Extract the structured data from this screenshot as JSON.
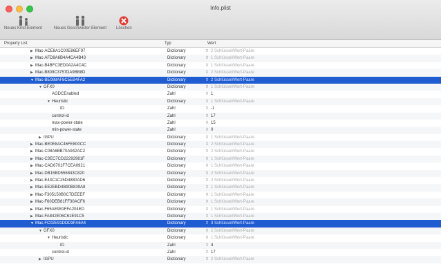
{
  "window": {
    "title": "Info.plist"
  },
  "toolbar": {
    "add_child": "Neues Kind-Element",
    "add_sibling": "Neues Geschwister-Element",
    "delete": "Löschen"
  },
  "columns": {
    "key": "Property List",
    "type": "Typ",
    "value": "Wert"
  },
  "rows": [
    {
      "key": "Mac-ACE8A1C00E86EF97",
      "type": "Dictionary",
      "value": "2 Schlüssel/Wert-Paare",
      "indent": 3,
      "disclosure": "closed",
      "selected": false
    },
    {
      "key": "Mac-AFD8A6B4A4CA4B43",
      "type": "Dictionary",
      "value": "1 Schlüssel/Wert-Paare",
      "indent": 3,
      "disclosure": "closed",
      "selected": false
    },
    {
      "key": "Mac-B4BFC3ED0A2A4C4C",
      "type": "Dictionary",
      "value": "1 Schlüssel/Wert-Paare",
      "indent": 3,
      "disclosure": "closed",
      "selected": false
    },
    {
      "key": "Mac-B809C3757DA9BB8D",
      "type": "Dictionary",
      "value": "2 Schlüssel/Wert-Paare",
      "indent": 3,
      "disclosure": "closed",
      "selected": false
    },
    {
      "key": "Mac-BE088AF8C5EB4FA2",
      "type": "Dictionary",
      "value": "2 Schlüssel/Wert-Paare",
      "indent": 3,
      "disclosure": "open",
      "selected": true
    },
    {
      "key": "GFX0",
      "type": "Dictionary",
      "value": "1 Schlüssel/Wert-Paare",
      "indent": 4,
      "disclosure": "open",
      "selected": false
    },
    {
      "key": "AGDCEnabled",
      "type": "Zahl",
      "value": "1",
      "indent": 5,
      "disclosure": "none",
      "selected": false
    },
    {
      "key": "Heuristic",
      "type": "Dictionary",
      "value": "1 Schlüssel/Wert-Paare",
      "indent": 5,
      "disclosure": "open",
      "selected": false
    },
    {
      "key": "ID",
      "type": "Zahl",
      "value": "-1",
      "indent": 6,
      "disclosure": "none",
      "selected": false
    },
    {
      "key": "control-id",
      "type": "Zahl",
      "value": "17",
      "indent": 5,
      "disclosure": "none",
      "selected": false
    },
    {
      "key": "max-power-state",
      "type": "Zahl",
      "value": "15",
      "indent": 5,
      "disclosure": "none",
      "selected": false
    },
    {
      "key": "min-power-state",
      "type": "Zahl",
      "value": "0",
      "indent": 5,
      "disclosure": "none",
      "selected": false
    },
    {
      "key": "IGPU",
      "type": "Dictionary",
      "value": "1 Schlüssel/Wert-Paare",
      "indent": 4,
      "disclosure": "closed",
      "selected": false
    },
    {
      "key": "Mac-BE0E8AC46FE800CC",
      "type": "Dictionary",
      "value": "2 Schlüssel/Wert-Paare",
      "indent": 3,
      "disclosure": "closed",
      "selected": false
    },
    {
      "key": "Mac-C08A6BB70A942AC2",
      "type": "Dictionary",
      "value": "2 Schlüssel/Wert-Paare",
      "indent": 3,
      "disclosure": "closed",
      "selected": false
    },
    {
      "key": "Mac-C3EC7CD22292981F",
      "type": "Dictionary",
      "value": "1 Schlüssel/Wert-Paare",
      "indent": 3,
      "disclosure": "closed",
      "selected": false
    },
    {
      "key": "Mac-CAD6701F7CEA0921",
      "type": "Dictionary",
      "value": "1 Schlüssel/Wert-Paare",
      "indent": 3,
      "disclosure": "closed",
      "selected": false
    },
    {
      "key": "Mac-DB15BD556843C820",
      "type": "Dictionary",
      "value": "2 Schlüssel/Wert-Paare",
      "indent": 3,
      "disclosure": "closed",
      "selected": false
    },
    {
      "key": "Mac-E43C1C25D4880AD6",
      "type": "Dictionary",
      "value": "2 Schlüssel/Wert-Paare",
      "indent": 3,
      "disclosure": "closed",
      "selected": false
    },
    {
      "key": "Mac-EE2EBD4B90B839A8",
      "type": "Dictionary",
      "value": "1 Schlüssel/Wert-Paare",
      "indent": 3,
      "disclosure": "closed",
      "selected": false
    },
    {
      "key": "Mac-F305150B0C7DEEEF",
      "type": "Dictionary",
      "value": "1 Schlüssel/Wert-Paare",
      "indent": 3,
      "disclosure": "closed",
      "selected": false
    },
    {
      "key": "Mac-F60DEB81FF30ACF6",
      "type": "Dictionary",
      "value": "1 Schlüssel/Wert-Paare",
      "indent": 3,
      "disclosure": "closed",
      "selected": false
    },
    {
      "key": "Mac-F65AE981FFA204ED",
      "type": "Dictionary",
      "value": "1 Schlüssel/Wert-Paare",
      "indent": 3,
      "disclosure": "closed",
      "selected": false
    },
    {
      "key": "Mac-FA842E06C61E91C5",
      "type": "Dictionary",
      "value": "1 Schlüssel/Wert-Paare",
      "indent": 3,
      "disclosure": "closed",
      "selected": false
    },
    {
      "key": "Mac-FC02E91DDD3FA6A4",
      "type": "Dictionary",
      "value": "3 Schlüssel/Wert-Paare",
      "indent": 3,
      "disclosure": "open",
      "selected": true
    },
    {
      "key": "GFX0",
      "type": "Dictionary",
      "value": "2 Schlüssel/Wert-Paare",
      "indent": 4,
      "disclosure": "open",
      "selected": false
    },
    {
      "key": "Heuristic",
      "type": "Dictionary",
      "value": "1 Schlüssel/Wert-Paare",
      "indent": 5,
      "disclosure": "open",
      "selected": false
    },
    {
      "key": "ID",
      "type": "Zahl",
      "value": "4",
      "indent": 6,
      "disclosure": "none",
      "selected": false
    },
    {
      "key": "control-id",
      "type": "Zahl",
      "value": "17",
      "indent": 5,
      "disclosure": "none",
      "selected": false
    },
    {
      "key": "IGPU",
      "type": "Dictionary",
      "value": "2 Schlüssel/Wert-Paare",
      "indent": 4,
      "disclosure": "closed",
      "selected": false
    }
  ]
}
